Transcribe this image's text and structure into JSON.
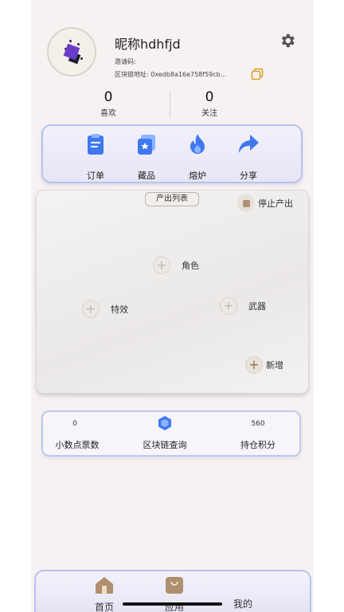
{
  "profile": {
    "nickname": "昵称hdhfjd",
    "invite_label": "邀请码:",
    "chain_address_label": "区块链地址:",
    "chain_address": "0xedb8a16e758f59cb..."
  },
  "stats": {
    "likes": {
      "value": "0",
      "label": "喜欢"
    },
    "follows": {
      "value": "0",
      "label": "关注"
    }
  },
  "menu": [
    {
      "label": "订单",
      "icon": "clipboard-icon"
    },
    {
      "label": "藏品",
      "icon": "collection-icon"
    },
    {
      "label": "熔炉",
      "icon": "flame-icon"
    },
    {
      "label": "分享",
      "icon": "share-arrow-icon"
    }
  ],
  "production": {
    "tab_label": "产出列表",
    "stop_label": "停止产出",
    "slots": {
      "role": "角色",
      "effect": "特效",
      "weapon": "武器",
      "add": "新增"
    }
  },
  "chain_info": {
    "points_value": "0",
    "points_label": "小数点票数",
    "query_label": "区块链查询",
    "holding_value": "560",
    "holding_label": "持仓积分"
  },
  "tabbar": {
    "home": "首页",
    "apps": "应用",
    "mine": "我的"
  },
  "colors": {
    "accent_blue": "#3f78f0",
    "card_border": "#b8c4ee",
    "brown_accent": "#b09070"
  }
}
